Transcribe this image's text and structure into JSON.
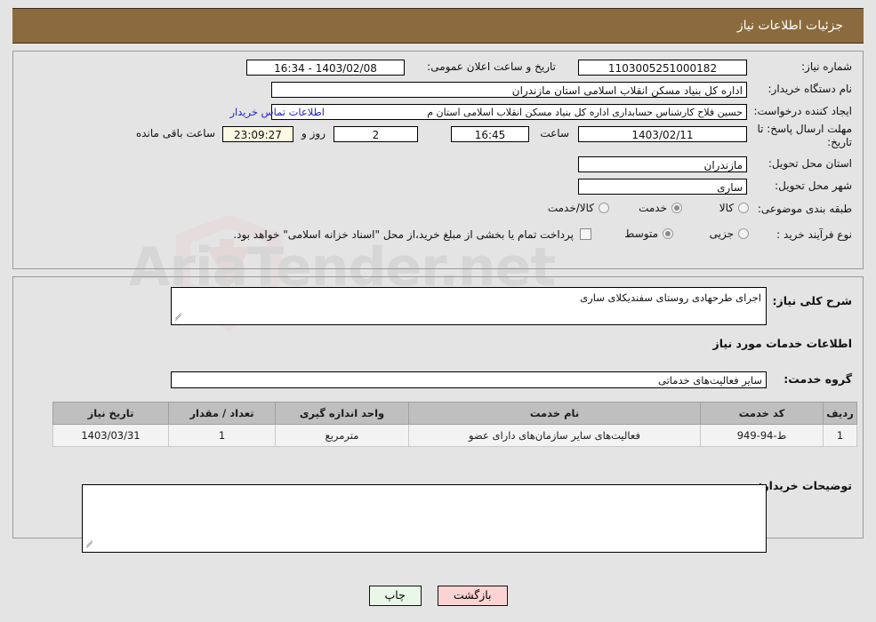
{
  "header": {
    "title": "جزئیات اطلاعات نیاز"
  },
  "watermark": {
    "text": "AriaTender.net"
  },
  "need_info": {
    "need_number_label": "شماره نیاز:",
    "need_number_value": "1103005251000182",
    "announce_datetime_label": "تاریخ و ساعت اعلان عمومی:",
    "announce_datetime_value": "1403/02/08 - 16:34",
    "buyer_org_label": "نام دستگاه خریدار:",
    "buyer_org_value": "اداره کل بنیاد مسکن انقلاب اسلامی استان مازندران",
    "creator_label": "ایجاد کننده درخواست:",
    "creator_value": "حسین فلاح کارشناس حسابداری اداره کل بنیاد مسکن انقلاب اسلامی استان م",
    "contact_link": "اطلاعات تماس خریدار",
    "deadline_label": "مهلت ارسال پاسخ: تا تاریخ:",
    "deadline_date": "1403/02/11",
    "deadline_hour_label": "ساعت",
    "deadline_hour_value": "16:45",
    "remaining_days_value": "2",
    "remaining_days_label": "روز و",
    "remaining_time_value": "23:09:27",
    "remaining_time_label": "ساعت باقی مانده",
    "province_label": "استان محل تحویل:",
    "province_value": "مازندران",
    "city_label": "شهر محل تحویل:",
    "city_value": "ساری",
    "category_label": "طبقه بندی موضوعی:",
    "category_options": [
      {
        "label": "کالا",
        "selected": false
      },
      {
        "label": "خدمت",
        "selected": true
      },
      {
        "label": "کالا/خدمت",
        "selected": false
      }
    ],
    "process_label": "نوع فرآیند خرید :",
    "process_options": [
      {
        "label": "جزیی",
        "selected": false
      },
      {
        "label": "متوسط",
        "selected": true
      }
    ],
    "treasury_checkbox_label": "پرداخت تمام یا بخشی از مبلغ خرید،از محل \"اسناد خزانه اسلامی\" خواهد بود.",
    "treasury_checked": false
  },
  "details": {
    "general_desc_label": "شرح کلی نیاز:",
    "general_desc_value": "اجرای طرحهادی روستای سفندیکلای ساری",
    "services_heading": "اطلاعات خدمات مورد نیاز",
    "service_group_label": "گروه خدمت:",
    "service_group_value": "سایر فعالیت‌های خدماتی",
    "table": {
      "headers": [
        "ردیف",
        "کد خدمت",
        "نام خدمت",
        "واحد اندازه گیری",
        "تعداد / مقدار",
        "تاریخ نیاز"
      ],
      "rows": [
        [
          "1",
          "ط-94-949",
          "فعالیت‌های سایر سازمان‌های دارای عضو",
          "مترمربع",
          "1",
          "1403/03/31"
        ]
      ]
    },
    "buyer_comments_label": "توضیحات خریدار:",
    "buyer_comments_value": ""
  },
  "footer": {
    "print_button": "چاپ",
    "back_button": "بازگشت"
  }
}
